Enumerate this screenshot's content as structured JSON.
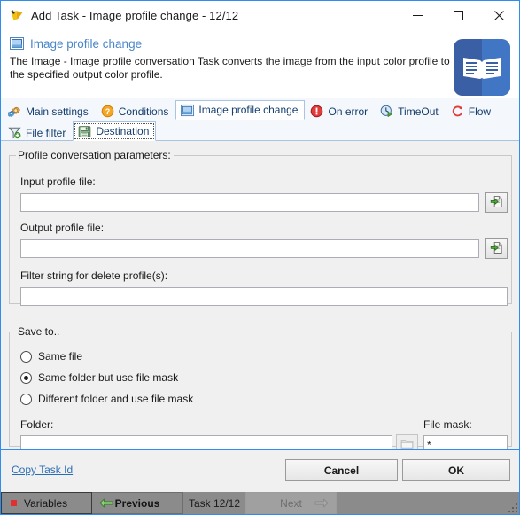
{
  "window": {
    "title": "Add Task - Image profile change - 12/12",
    "icon": "app-bird-icon",
    "controls": {
      "minimize": "minimize-icon",
      "maximize": "maximize-icon",
      "close": "close-icon"
    },
    "accent_border": "#2E8DEF"
  },
  "header": {
    "icon": "image-profile-icon",
    "title": "Image profile change",
    "title_color": "#4a86c8",
    "description": "The Image - Image profile conversation Task converts the image from the input color profile to the specified output color profile.",
    "badge_icon": "book-icon",
    "badge_color": "#3B5FA5"
  },
  "tabs": {
    "row1": [
      {
        "label": "Main settings",
        "icon": "gears-icon",
        "selected": false
      },
      {
        "label": "Conditions",
        "icon": "question-orange-icon",
        "selected": false
      },
      {
        "label": "Image profile change",
        "icon": "image-profile-icon",
        "selected": true
      },
      {
        "label": "On error",
        "icon": "error-red-icon",
        "selected": false
      },
      {
        "label": "TimeOut",
        "icon": "clock-green-icon",
        "selected": false
      },
      {
        "label": "Flow",
        "icon": "flow-red-icon",
        "selected": false
      }
    ],
    "row2": [
      {
        "label": "File filter",
        "icon": "filter-icon",
        "selected": false
      },
      {
        "label": "Destination",
        "icon": "save-disk-icon",
        "selected": true
      }
    ]
  },
  "params_group": {
    "legend": "Profile conversation parameters:",
    "input_profile": {
      "label": "Input profile file:",
      "value": "",
      "placeholder": "",
      "browse_icon": "open-file-icon"
    },
    "output_profile": {
      "label": "Output profile file:",
      "value": "",
      "placeholder": "",
      "browse_icon": "open-file-icon"
    },
    "filter_string": {
      "label": "Filter string for delete profile(s):",
      "value": "",
      "placeholder": ""
    }
  },
  "saveto_group": {
    "legend": "Save to..",
    "options": [
      {
        "label": "Same file",
        "checked": false
      },
      {
        "label": "Same folder but use file mask",
        "checked": true
      },
      {
        "label": "Different folder and use file mask",
        "checked": false
      }
    ],
    "folder": {
      "label": "Folder:",
      "value": "",
      "placeholder": "",
      "browse_icon": "folder-icon",
      "browse_disabled": true
    },
    "file_mask": {
      "label": "File mask:",
      "value": "*",
      "placeholder": ""
    }
  },
  "footer": {
    "copy_task_id": "Copy Task Id",
    "cancel": "Cancel",
    "ok": "OK"
  },
  "statusbar": {
    "variables": "Variables",
    "previous": "Previous",
    "task_counter": "Task 12/12",
    "next": "Next"
  }
}
